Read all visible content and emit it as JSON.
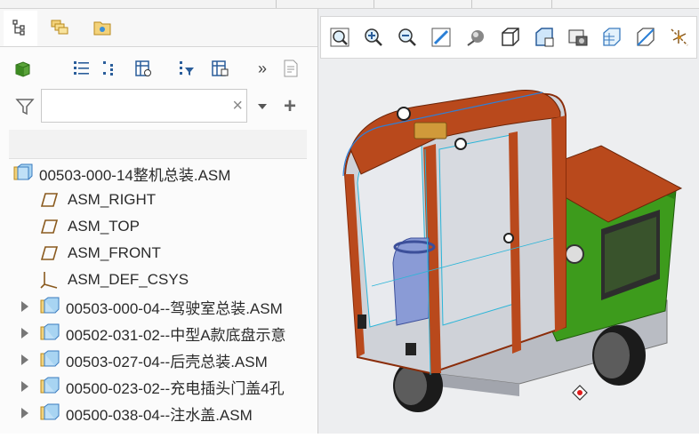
{
  "toolbar_top": {
    "visible": true
  },
  "search": {
    "placeholder": "",
    "value": ""
  },
  "tree": {
    "root": {
      "label": "00503-000-14整机总装.ASM"
    },
    "datums": [
      {
        "label": "ASM_RIGHT"
      },
      {
        "label": "ASM_TOP"
      },
      {
        "label": "ASM_FRONT"
      },
      {
        "label": "ASM_DEF_CSYS"
      }
    ],
    "components": [
      {
        "label": "00503-000-04--驾驶室总装.ASM"
      },
      {
        "label": "00502-031-02--中型A款底盘示意"
      },
      {
        "label": "00503-027-04--后壳总装.ASM"
      },
      {
        "label": "00500-023-02--充电插头门盖4孔"
      },
      {
        "label": "00500-038-04--注水盖.ASM"
      }
    ]
  },
  "icons": {
    "tabs": [
      "model-tree-icon",
      "layer-tree-icon",
      "folder-browser-icon"
    ],
    "tree_toolbar": [
      "part-cube-icon",
      "tree-settings-icon",
      "tree-expand-icon",
      "column-display-icon",
      "filter-tree-icon",
      "show-tree-icon",
      "more-chevron-icon",
      "notes-icon"
    ],
    "view_toolbar": [
      "refit-icon",
      "zoom-in-icon",
      "zoom-out-icon",
      "repaint-icon",
      "display-style-icon",
      "saved-orientations-icon",
      "view-manager-icon",
      "perspective-icon",
      "spin-center-icon",
      "annotation-display-icon",
      "datum-display-icon"
    ]
  },
  "colors": {
    "cab_orange": "#b9491c",
    "body_green": "#3d9b1c",
    "frame_gray": "#c4c6cc",
    "accent_blue": "#2f7fd6",
    "highlight_cyan": "#2bb5d8"
  }
}
